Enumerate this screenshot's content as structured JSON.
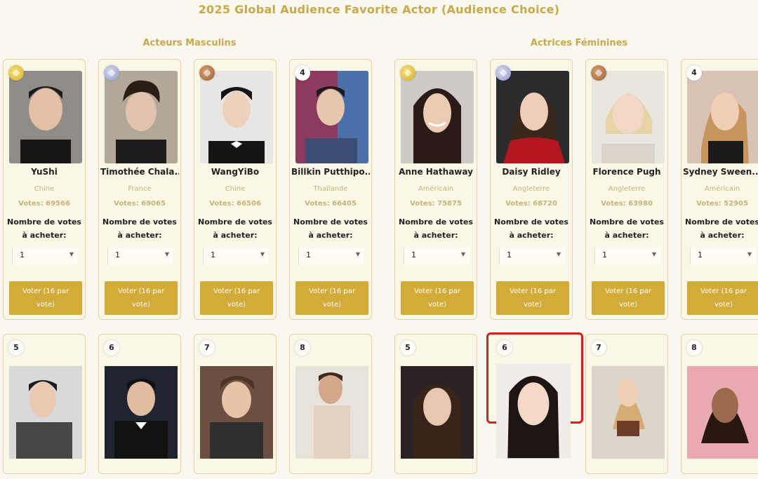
{
  "page": {
    "title": "2025 Global Audience Favorite Actor (Audience Choice)"
  },
  "sections": {
    "male": "Acteurs Masculins",
    "female": "Actrices Féminines"
  },
  "common": {
    "buy_label_1": "Nombre de votes",
    "buy_label_2": "à acheter:",
    "qty_value": "1",
    "vote_btn_1": "Voter (16 par",
    "vote_btn_2": "vote)"
  },
  "male_row1": [
    {
      "rank": "1",
      "medal": "gold",
      "name": "YuShi",
      "country": "Chine",
      "votes": "Votes: 69566"
    },
    {
      "rank": "2",
      "medal": "silver",
      "name": "Timothée Chala...",
      "country": "France",
      "votes": "Votes: 69065"
    },
    {
      "rank": "3",
      "medal": "bronze",
      "name": "WangYiBo",
      "country": "Chine",
      "votes": "Votes: 66506"
    },
    {
      "rank": "4",
      "medal": "",
      "name": "Billkin Putthipo...",
      "country": "Thaïlande",
      "votes": "Votes: 66405"
    }
  ],
  "female_row1": [
    {
      "rank": "1",
      "medal": "gold",
      "name": "Anne Hathaway",
      "country": "Américain",
      "votes": "Votes: 75875"
    },
    {
      "rank": "2",
      "medal": "silver",
      "name": "Daisy Ridley",
      "country": "Angleterre",
      "votes": "Votes: 68720"
    },
    {
      "rank": "3",
      "medal": "bronze",
      "name": "Florence Pugh",
      "country": "Angleterre",
      "votes": "Votes: 63980"
    },
    {
      "rank": "4",
      "medal": "",
      "name": "Sydney Sween...",
      "country": "Américain",
      "votes": "Votes: 52905"
    }
  ],
  "male_row2": [
    "5",
    "6",
    "7",
    "8"
  ],
  "female_row2": [
    "5",
    "6",
    "7",
    "8"
  ],
  "colors": {
    "accent": "#d3ab38",
    "title": "#c7a94a",
    "highlight": "#d0241b"
  }
}
